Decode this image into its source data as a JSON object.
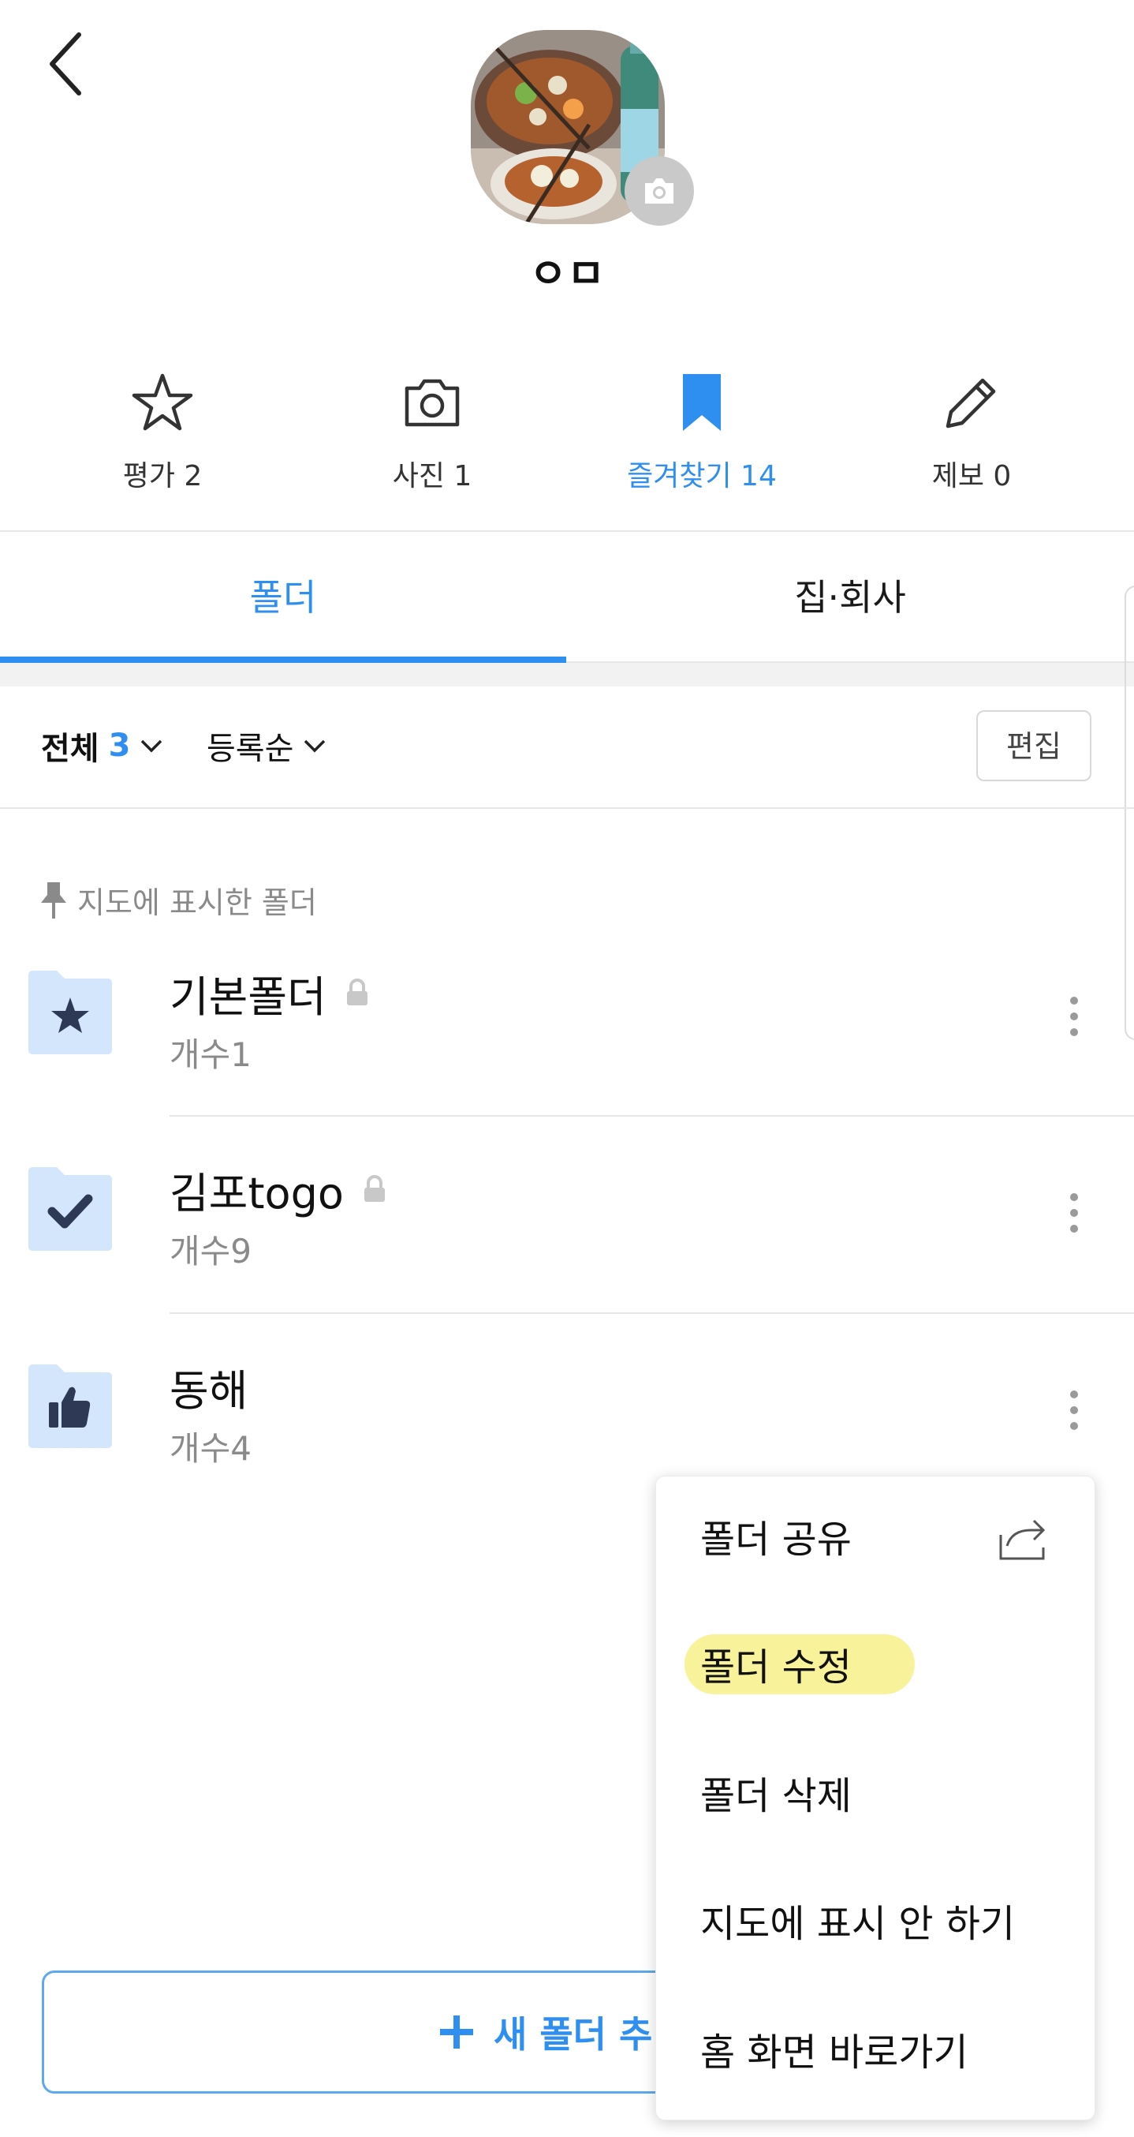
{
  "header": {
    "back_icon": "chevron-left-icon",
    "profile_name": "ㅇㅁ",
    "avatar_desc": "food-photo",
    "camera_badge_icon": "camera-icon"
  },
  "stats": [
    {
      "icon": "star-outline-icon",
      "label": "평가 2"
    },
    {
      "icon": "camera-outline-icon",
      "label": "사진 1"
    },
    {
      "icon": "bookmark-filled-icon",
      "label": "즐겨찾기 14",
      "active": true
    },
    {
      "icon": "pencil-icon",
      "label": "제보 0"
    }
  ],
  "tabs": [
    {
      "label": "폴더",
      "active": true
    },
    {
      "label": "집·회사",
      "active": false
    }
  ],
  "filter": {
    "all_label": "전체",
    "all_count": "3",
    "sort_label": "등록순",
    "edit_label": "편집"
  },
  "pinned_label": "지도에 표시한 폴더",
  "folders": [
    {
      "name": "기본폴더",
      "count": "개수1",
      "icon": "star-icon",
      "locked": true
    },
    {
      "name": "김포togo",
      "count": "개수9",
      "icon": "checkmark-icon",
      "locked": true
    },
    {
      "name": "동해",
      "count": "개수4",
      "icon": "thumbs-up-icon",
      "locked": false
    }
  ],
  "new_folder_button": "새 폴더 추",
  "context_menu": {
    "share": "폴더 공유",
    "edit": "폴더 수정",
    "delete": "폴더 삭제",
    "hide_on_map": "지도에 표시 안 하기",
    "home_shortcut": "홈 화면 바로가기"
  },
  "colors": {
    "accent": "#2f8ff0",
    "folder_bg": "#d3e6fb",
    "folder_glyph": "#2e3a55",
    "highlight": "#f7f18a"
  }
}
